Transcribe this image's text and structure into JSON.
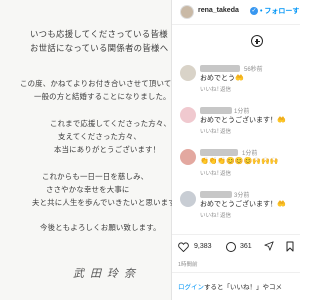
{
  "post": {
    "letter": {
      "lines": [
        "いつも応援してくださっている皆様",
        "お世話になっている関係者の皆様へ",
        "この度、かねてよりお付き合いさせて頂いていた",
        "一般の方と結婚することになりました。",
        "これまで応援してくださった方々、",
        "支えてくださった方々、",
        "本当にありがとうございます！",
        "これからも一日一日を慈しみ、",
        "ささやかな幸せを大事に",
        "夫と共に人生を歩んでいきたいと思います。",
        "今後ともよろしくお願い致します。"
      ],
      "signature": "武田玲奈"
    }
  },
  "header": {
    "username": "rena_takeda",
    "verified_mark": "✓",
    "follow_label": "• フォローする"
  },
  "comments": [
    {
      "time": "56秒前",
      "text": "おめでとう🤲",
      "like": "いいね！",
      "reply": "返信",
      "avatar_color": "#d9d3c8"
    },
    {
      "time": "1分前",
      "text": "おめでとうございます！🤲",
      "like": "いいね！",
      "reply": "返信",
      "avatar_color": "#f0c9cf"
    },
    {
      "time": "1分前",
      "text": "👏👏👏😊😊😊🙌🙌🙌",
      "like": "いいね！",
      "reply": "返信",
      "avatar_color": "#e3a8a0"
    },
    {
      "time": "3分前",
      "text": "おめでとうございます！🤲",
      "like": "いいね！",
      "reply": "返信",
      "avatar_color": "#c8cdd4"
    }
  ],
  "actions": {
    "likes": "9,383",
    "comments": "361"
  },
  "post_time": "1時間前",
  "login": {
    "link": "ログイン",
    "rest": "すると「いいね！」やコメ"
  },
  "colors": {
    "accent": "#0095f6",
    "verified": "#3897f0"
  }
}
